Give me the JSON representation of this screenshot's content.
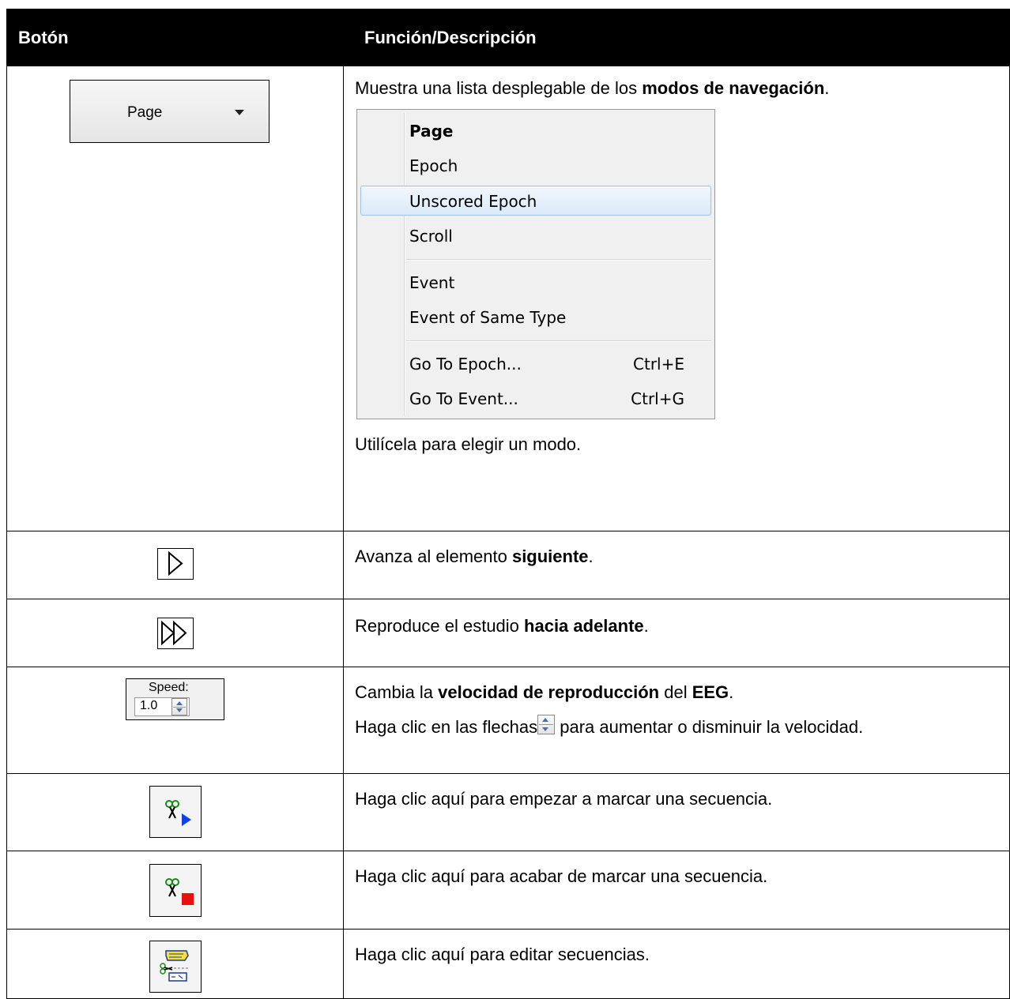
{
  "header": {
    "col1": "Botón",
    "col2": "Función/Descripción"
  },
  "rows": {
    "nav_mode": {
      "button_label": "Page",
      "desc_prefix": "Muestra una lista desplegable de los ",
      "desc_bold": "modos de navegación",
      "desc_suffix": ".",
      "menu": {
        "items": [
          {
            "label": "Page",
            "bold": true
          },
          {
            "label": "Epoch"
          },
          {
            "label": "Unscored Epoch",
            "highlighted": true
          },
          {
            "label": "Scroll"
          },
          {
            "label": "Event"
          },
          {
            "label": "Event of Same Type"
          },
          {
            "label": "Go To Epoch...",
            "shortcut": "Ctrl+E"
          },
          {
            "label": "Go To Event...",
            "shortcut": "Ctrl+G"
          }
        ]
      },
      "after_menu": "Utilícela para elegir un modo."
    },
    "next": {
      "icon": "step-forward-icon",
      "desc_prefix": "Avanza al elemento ",
      "desc_bold": "siguiente",
      "desc_suffix": "."
    },
    "play": {
      "icon": "play-forward-icon",
      "desc_prefix": "Reproduce el estudio ",
      "desc_bold": "hacia adelante",
      "desc_suffix": "."
    },
    "speed": {
      "speed_label": "Speed:",
      "speed_value": "1.0",
      "desc_prefix": "Cambia la ",
      "desc_bold1": "velocidad de reproducción",
      "desc_mid": " del ",
      "desc_bold2": "EEG",
      "desc_suffix": ".",
      "desc2_prefix": "Haga clic en las flechas",
      "desc2_suffix": " para aumentar o disminuir la velocidad."
    },
    "seq_start": {
      "icon": "scissors-play-icon",
      "desc": "Haga clic aquí para empezar a marcar una secuencia."
    },
    "seq_stop": {
      "icon": "scissors-stop-icon",
      "desc": "Haga clic aquí para acabar de marcar una secuencia."
    },
    "seq_edit": {
      "icon": "edit-sequences-icon",
      "desc": "Haga clic aquí para editar secuencias."
    }
  }
}
